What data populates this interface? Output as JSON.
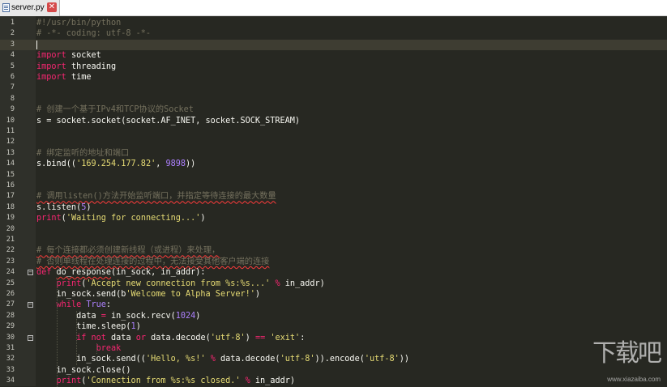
{
  "tab": {
    "filename": "server.py",
    "close_glyph": "✕",
    "icon": "python-file-icon"
  },
  "editor": {
    "active_line": 3,
    "lines": [
      {
        "n": "1",
        "code": [
          {
            "t": "#!/usr/bin/python",
            "c": "c"
          }
        ]
      },
      {
        "n": "2",
        "code": [
          {
            "t": "# -*- coding: utf-8 -*-",
            "c": "c"
          }
        ]
      },
      {
        "n": "3",
        "code": []
      },
      {
        "n": "4",
        "code": [
          {
            "t": "import",
            "c": "k"
          },
          {
            "t": " socket"
          }
        ]
      },
      {
        "n": "5",
        "code": [
          {
            "t": "import",
            "c": "k"
          },
          {
            "t": " threading"
          }
        ]
      },
      {
        "n": "6",
        "code": [
          {
            "t": "import",
            "c": "k"
          },
          {
            "t": " time"
          }
        ]
      },
      {
        "n": "7",
        "code": []
      },
      {
        "n": "8",
        "code": []
      },
      {
        "n": "9",
        "code": [
          {
            "t": "# 创建一个基于IPv4和TCP协议的Socket",
            "c": "c"
          }
        ]
      },
      {
        "n": "10",
        "code": [
          {
            "t": "s = socket.socket(socket.AF_INET, socket.SOCK_STREAM)"
          }
        ]
      },
      {
        "n": "11",
        "code": []
      },
      {
        "n": "12",
        "code": []
      },
      {
        "n": "13",
        "code": [
          {
            "t": "# 绑定监听的地址和端口",
            "c": "c"
          }
        ]
      },
      {
        "n": "14",
        "code": [
          {
            "t": "s.bind(("
          },
          {
            "t": "'169.254.177.82'",
            "c": "s"
          },
          {
            "t": ", "
          },
          {
            "t": "9898",
            "c": "n"
          },
          {
            "t": "))"
          }
        ]
      },
      {
        "n": "15",
        "code": []
      },
      {
        "n": "16",
        "code": []
      },
      {
        "n": "17",
        "code": [
          {
            "t": "# 调用listen()方法开始监听端口，并指定等待连接的最大数量",
            "c": "c u"
          }
        ]
      },
      {
        "n": "18",
        "code": [
          {
            "t": "s.listen("
          },
          {
            "t": "5",
            "c": "n"
          },
          {
            "t": ")"
          }
        ]
      },
      {
        "n": "19",
        "code": [
          {
            "t": "print",
            "c": "k"
          },
          {
            "t": "("
          },
          {
            "t": "'Waiting for connecting...'",
            "c": "s"
          },
          {
            "t": ")"
          }
        ]
      },
      {
        "n": "20",
        "code": []
      },
      {
        "n": "21",
        "code": []
      },
      {
        "n": "22",
        "code": [
          {
            "t": "# 每个连接都必须创建新线程（或进程）来处理，",
            "c": "c u"
          }
        ]
      },
      {
        "n": "23",
        "code": [
          {
            "t": "# 否则单线程在处理连接的过程中，无法接受其他客户端的连接",
            "c": "c u"
          }
        ]
      },
      {
        "n": "24",
        "fold": true,
        "code": [
          {
            "t": "def",
            "c": "k"
          },
          {
            "t": " "
          },
          {
            "t": "do_response",
            "c": "u"
          },
          {
            "t": "(in_sock, in_addr):"
          }
        ]
      },
      {
        "n": "25",
        "code": [
          {
            "t": "    "
          },
          {
            "t": "print",
            "c": "k"
          },
          {
            "t": "("
          },
          {
            "t": "'Accept new connection from %s:%s...'",
            "c": "s"
          },
          {
            "t": " "
          },
          {
            "t": "%",
            "c": "k"
          },
          {
            "t": " in_addr)"
          }
        ]
      },
      {
        "n": "26",
        "code": [
          {
            "t": "    in_sock.send(b"
          },
          {
            "t": "'Welcome to Alpha Server!'",
            "c": "s"
          },
          {
            "t": ")"
          }
        ]
      },
      {
        "n": "27",
        "fold": true,
        "code": [
          {
            "t": "    "
          },
          {
            "t": "while",
            "c": "k"
          },
          {
            "t": " "
          },
          {
            "t": "True",
            "c": "n"
          },
          {
            "t": ":"
          }
        ]
      },
      {
        "n": "28",
        "code": [
          {
            "t": "        data "
          },
          {
            "t": "=",
            "c": "k"
          },
          {
            "t": " in_sock.recv("
          },
          {
            "t": "1024",
            "c": "n"
          },
          {
            "t": ")"
          }
        ]
      },
      {
        "n": "29",
        "code": [
          {
            "t": "        time.sleep("
          },
          {
            "t": "1",
            "c": "n"
          },
          {
            "t": ")"
          }
        ]
      },
      {
        "n": "30",
        "fold": true,
        "code": [
          {
            "t": "        "
          },
          {
            "t": "if",
            "c": "k"
          },
          {
            "t": " "
          },
          {
            "t": "not",
            "c": "k"
          },
          {
            "t": " data "
          },
          {
            "t": "or",
            "c": "k"
          },
          {
            "t": " data.decode("
          },
          {
            "t": "'utf-8'",
            "c": "s"
          },
          {
            "t": ") "
          },
          {
            "t": "==",
            "c": "k"
          },
          {
            "t": " "
          },
          {
            "t": "'exit'",
            "c": "s"
          },
          {
            "t": ":"
          }
        ]
      },
      {
        "n": "31",
        "code": [
          {
            "t": "            "
          },
          {
            "t": "break",
            "c": "k"
          }
        ]
      },
      {
        "n": "32",
        "code": [
          {
            "t": "        in_sock.send(("
          },
          {
            "t": "'Hello, %s!'",
            "c": "s"
          },
          {
            "t": " "
          },
          {
            "t": "%",
            "c": "k"
          },
          {
            "t": " data.decode("
          },
          {
            "t": "'utf-8'",
            "c": "s"
          },
          {
            "t": ")).encode("
          },
          {
            "t": "'utf-8'",
            "c": "s"
          },
          {
            "t": "))"
          }
        ]
      },
      {
        "n": "33",
        "code": [
          {
            "t": "    in_sock.close()"
          }
        ]
      },
      {
        "n": "34",
        "code": [
          {
            "t": "    "
          },
          {
            "t": "print",
            "c": "k"
          },
          {
            "t": "("
          },
          {
            "t": "'Connection from %s:%s closed.'",
            "c": "s"
          },
          {
            "t": " "
          },
          {
            "t": "%",
            "c": "k"
          },
          {
            "t": " in_addr)"
          }
        ]
      }
    ]
  },
  "watermark": {
    "logo": "下载吧",
    "url": "www.xiazaiba.com"
  },
  "colors": {
    "background": "#272822",
    "keyword": "#f92672",
    "string": "#e6db74",
    "number": "#ae81ff",
    "comment": "#75715e"
  }
}
